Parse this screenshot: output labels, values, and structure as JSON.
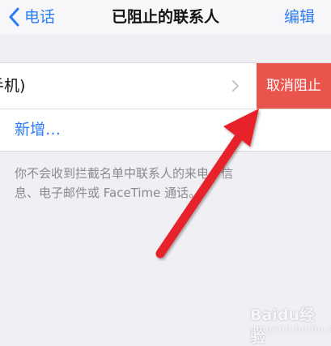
{
  "nav": {
    "back_label": "电话",
    "title": "已阻止的联系人",
    "edit_label": "编辑"
  },
  "blocked_list": {
    "contact_label": "手机)",
    "unblock_label": "取消阻止",
    "add_label": "新增…"
  },
  "footer": {
    "line1": "你不会收到拦截名单中联系人的来电、信",
    "line2": "息、电子邮件或 FaceTime 通话。"
  },
  "colors": {
    "accent": "#2b7cf6",
    "unblock_bg": "#e9554c",
    "annotation_arrow": "#e8202a"
  },
  "watermark": {
    "brand": "Baidu经验",
    "sub": "jingyan.baidu.com"
  },
  "icons": {
    "back": "chevron-left-icon",
    "disclosure": "chevron-right-icon",
    "annotation": "red-arrow-icon"
  }
}
